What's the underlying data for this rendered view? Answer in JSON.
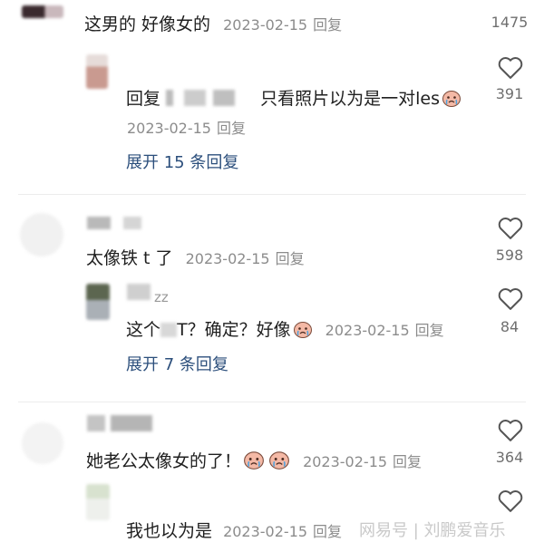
{
  "comments": [
    {
      "text": "这男的 好像女的",
      "date": "2023-02-15",
      "reply_label": "回复",
      "likes": "1475",
      "reply": {
        "prefix": "回复",
        "text": "只看照片以为是一对les",
        "date": "2023-02-15",
        "reply_label": "回复",
        "likes": "391",
        "emoji": "crying-face-emoji"
      },
      "expand": "展开 15 条回复"
    },
    {
      "text": "太像铁 t 了",
      "date": "2023-02-15",
      "reply_label": "回复",
      "likes": "598",
      "reply": {
        "username_partial": "zz",
        "text_before": "这个",
        "text_mid": "T？确定？好像",
        "date": "2023-02-15",
        "reply_label": "回复",
        "likes": "84",
        "emoji": "crying-face-emoji"
      },
      "expand": "展开 7 条回复"
    },
    {
      "text": "她老公太像女的了！",
      "date": "2023-02-15",
      "reply_label": "回复",
      "likes": "364",
      "emojis": [
        "crying-face-emoji",
        "crying-face-emoji"
      ],
      "reply": {
        "text": "我也以为是",
        "date": "2023-02-15",
        "reply_label": "回复"
      }
    }
  ],
  "watermark": "网易号 | 刘鹏爱音乐",
  "icons": {
    "like": "heart-outline-icon"
  }
}
